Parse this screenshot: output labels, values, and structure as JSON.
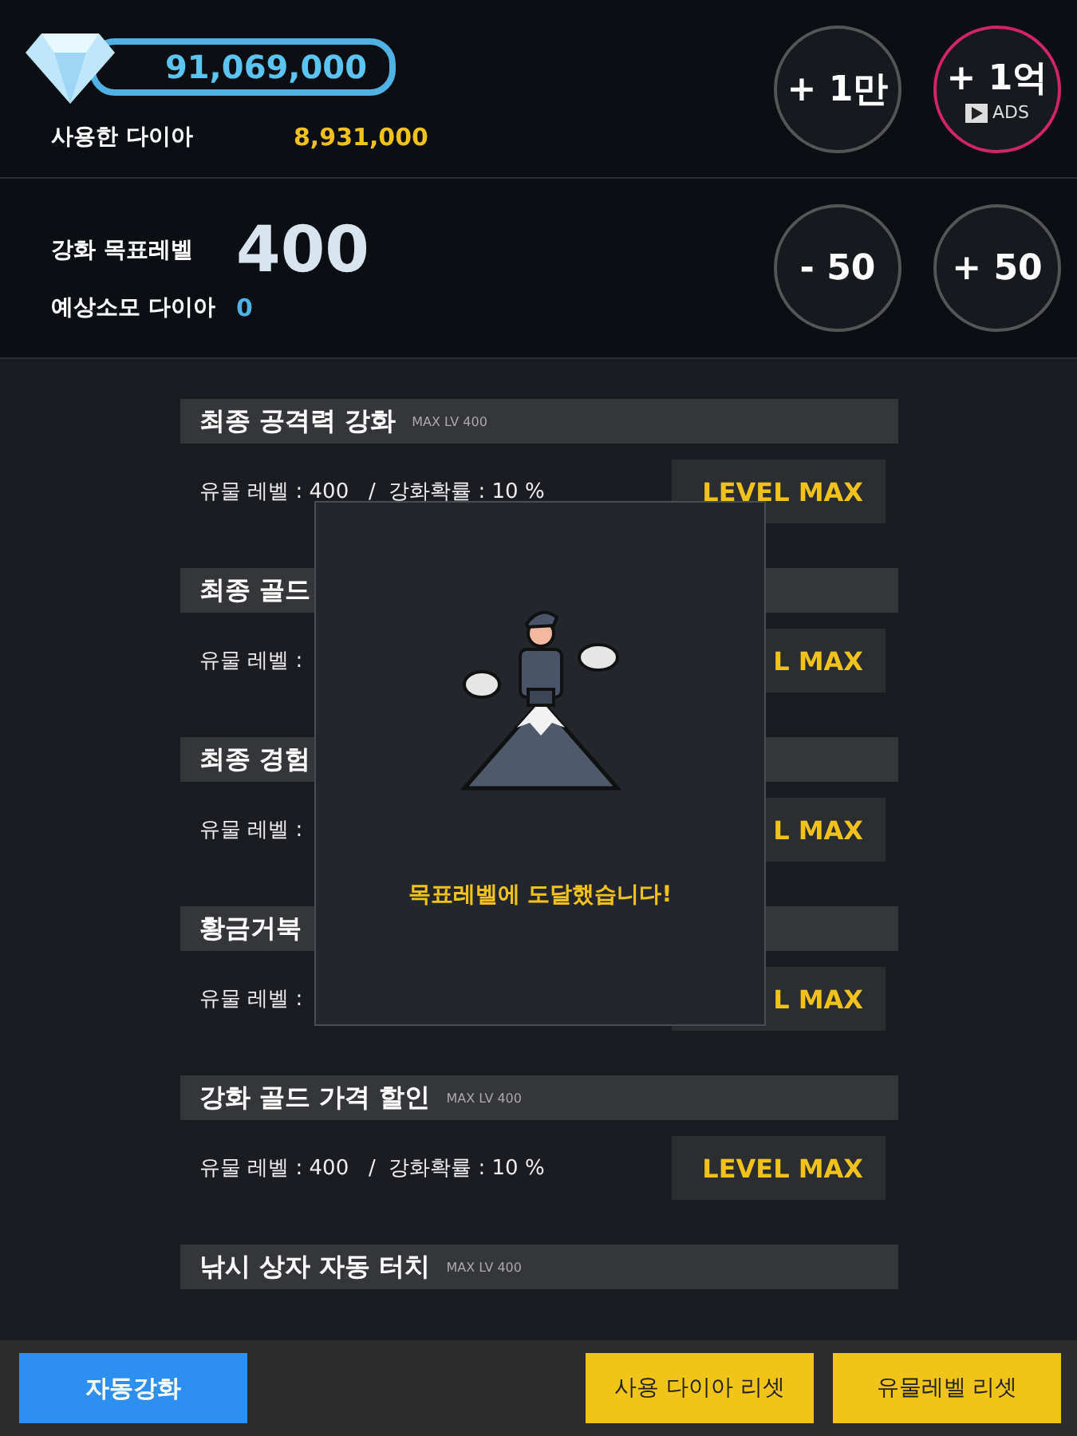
{
  "wallet": {
    "diamonds": "91,069,000",
    "used_label": "사용한 다이아",
    "used_value": "8,931,000"
  },
  "top_buttons": [
    {
      "label": "+ 1만",
      "kind": "plain"
    },
    {
      "label": "+ 1억",
      "kind": "ads",
      "badge": "ADS"
    }
  ],
  "target": {
    "label": "강화 목표레벨",
    "level": "400",
    "cost_label": "예상소모 다이아",
    "cost_value": "0"
  },
  "step_buttons": [
    {
      "label": "- 50"
    },
    {
      "label": "+ 50"
    }
  ],
  "relics": [
    {
      "title": "최종 공격력 강화",
      "max_label": "MAX LV 400",
      "level_text": "유물 레벨 : 400   /  강화확률 : 10 %",
      "button": "LEVEL MAX"
    },
    {
      "title": "최종 골드",
      "level_text": "유물 레벨 :",
      "button": "L MAX"
    },
    {
      "title": "최종 경험",
      "level_text": "유물 레벨 :",
      "button": "L MAX"
    },
    {
      "title": "황금거북",
      "level_text": "유물 레벨 :",
      "button": "L MAX"
    },
    {
      "title": "강화 골드 가격 할인",
      "max_label": "MAX LV 400",
      "level_text": "유물 레벨 : 400   /  강화확률 : 10 %",
      "button": "LEVEL MAX"
    },
    {
      "title": "낚시 상자 자동 터치",
      "max_label": "MAX LV 400"
    }
  ],
  "dialog": {
    "message": "목표레벨에 도달했습니다!"
  },
  "footer": {
    "auto_button": "자동강화",
    "reset_buttons": [
      "사용 다이아 리셋",
      "유물레벨 리셋"
    ]
  }
}
